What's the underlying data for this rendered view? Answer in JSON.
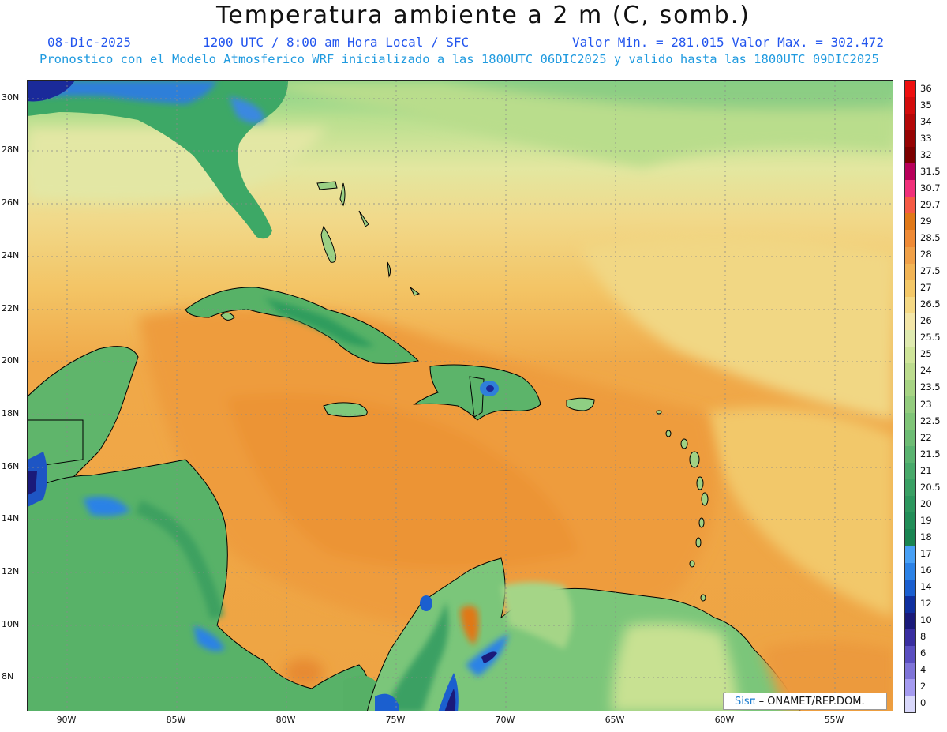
{
  "header": {
    "title": "Temperatura ambiente a 2 m (C, somb.)",
    "date": "08-Dic-2025",
    "time_info": "1200 UTC / 8:00 am Hora Local / SFC",
    "min_max": "Valor Min. = 281.015  Valor Max. = 302.472",
    "model_info": "Pronostico con el Modelo Atmosferico WRF inicializado a las 1800UTC_06DIC2025 y valido hasta las  1800UTC_09DIC2025"
  },
  "map": {
    "extent": {
      "lon_min": -92,
      "lon_max": -52.5,
      "lat_min": 6.8,
      "lat_max": 30.8
    },
    "lat_labels": [
      "30N",
      "28N",
      "26N",
      "24N",
      "22N",
      "20N",
      "18N",
      "16N",
      "14N",
      "12N",
      "10N",
      "8N"
    ],
    "lon_labels": [
      "90W",
      "85W",
      "80W",
      "75W",
      "70W",
      "65W",
      "60W",
      "55W"
    ],
    "colors": {
      "ocean_warm": "#f0a848",
      "ocean_mild": "#f4c870",
      "ocean_cool": "#f0df8c",
      "subtropical": "#e5eaa0",
      "north": "#c7e393",
      "land_low": "#4fae62",
      "land_mid": "#7ec87c",
      "highland": "#2e78d8",
      "cold_core": "#1b2aa6"
    }
  },
  "legend": {
    "labels": [
      "36",
      "35",
      "34",
      "33",
      "32",
      "31.5",
      "30.7",
      "29.7",
      "29",
      "28.5",
      "28",
      "27.5",
      "27",
      "26.5",
      "26",
      "25.5",
      "25",
      "24",
      "23.5",
      "23",
      "22.5",
      "22",
      "21.5",
      "21",
      "20.5",
      "20",
      "19",
      "18",
      "17",
      "16",
      "14",
      "12",
      "10",
      "8",
      "6",
      "4",
      "2",
      "0"
    ],
    "colors": [
      "#ee1010",
      "#d20c0c",
      "#b40808",
      "#960404",
      "#7c0000",
      "#b8005a",
      "#f0307a",
      "#f55a45",
      "#e07818",
      "#ef8a36",
      "#f0a048",
      "#f2b455",
      "#f4c868",
      "#f5d985",
      "#f3e6a8",
      "#dfeab0",
      "#cfe59a",
      "#bcdc8e",
      "#a7d484",
      "#93cc7e",
      "#80c578",
      "#6dbc74",
      "#5ab370",
      "#48a96a",
      "#3aa064",
      "#2d975e",
      "#228e58",
      "#1a8552",
      "#48a0f5",
      "#2c82e6",
      "#1b5fcf",
      "#102f9e",
      "#1a1a7a",
      "#3a2ea0",
      "#5a4ec0",
      "#7f74d8",
      "#a59bf0",
      "#d9d8fb"
    ]
  },
  "credit": {
    "logo": "Sisπ",
    "text": "– ONAMET/REP.DOM."
  }
}
